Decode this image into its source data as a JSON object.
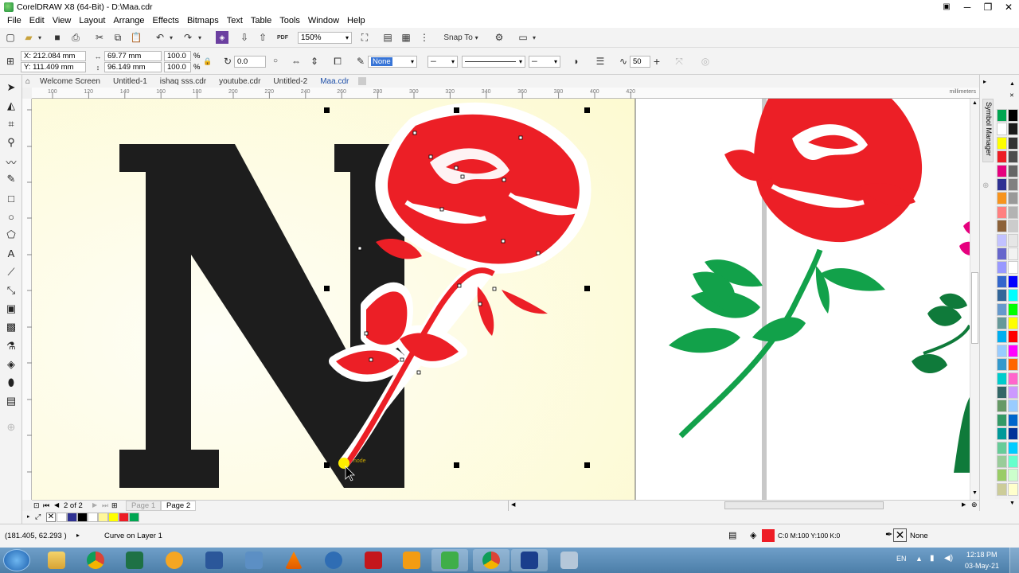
{
  "window": {
    "title": "CorelDRAW X8 (64-Bit) - D:\\Maa.cdr",
    "controls": [
      "minimize",
      "restore",
      "close"
    ]
  },
  "menu": [
    "File",
    "Edit",
    "View",
    "Layout",
    "Arrange",
    "Effects",
    "Bitmaps",
    "Text",
    "Table",
    "Tools",
    "Window",
    "Help"
  ],
  "standard_toolbar": {
    "zoom": "150%",
    "snap_label": "Snap To"
  },
  "property_bar": {
    "x": "X: 212.084 mm",
    "y": "Y: 111.409 mm",
    "width": "69.77 mm",
    "height": "96.149 mm",
    "scale_x": "100.0",
    "scale_y": "100.0",
    "pct": "%",
    "rotation": "0.0",
    "outline_width": "None",
    "smoothing": "50"
  },
  "tabs": [
    {
      "label": "Welcome Screen",
      "active": false
    },
    {
      "label": "Untitled-1",
      "active": false
    },
    {
      "label": "ishaq sss.cdr",
      "active": false
    },
    {
      "label": "youtube.cdr",
      "active": false
    },
    {
      "label": "Untitled-2",
      "active": false
    },
    {
      "label": "Maa.cdr",
      "active": true
    }
  ],
  "ruler": {
    "ticks": [
      "100",
      "120",
      "140",
      "160",
      "180",
      "200",
      "220",
      "240",
      "260",
      "280",
      "300",
      "320",
      "340",
      "360",
      "380",
      "400",
      "420"
    ],
    "unit": "millimeters"
  },
  "canvas": {
    "node_label": "node"
  },
  "docker": {
    "label": "Symbol Manager"
  },
  "page_nav": {
    "counter": "2 of 2",
    "pages": [
      "Page 1",
      "Page 2"
    ]
  },
  "status": {
    "coords": "(181.405, 62.293 )",
    "info": "Curve on Layer 1",
    "fill": "C:0 M:100 Y:100 K:0",
    "fill_color": "#ee1c25",
    "outline": "None"
  },
  "palette_colors": [
    "#00a651",
    "#000000",
    "#ffffff",
    "#1a1a1a",
    "#ffff00",
    "#333333",
    "#ed1c24",
    "#4d4d4d",
    "#e6007e",
    "#666666",
    "#2e3192",
    "#808080",
    "#f7941d",
    "#999999",
    "#ff8080",
    "#b3b3b3",
    "#8c6239",
    "#cccccc",
    "#c2c2ff",
    "#e6e6e6",
    "#6666cc",
    "#f2f2f2",
    "#9999ff",
    "#ffffff",
    "#3366cc",
    "#0000ff",
    "#336699",
    "#00ffff",
    "#6699cc",
    "#00ff00",
    "#669999",
    "#ffff00",
    "#00aeef",
    "#ff0000",
    "#99ccff",
    "#ff00ff",
    "#3399cc",
    "#ff6600",
    "#00cccc",
    "#ff66cc",
    "#336666",
    "#cc99ff",
    "#669966",
    "#99ccff",
    "#339966",
    "#0066cc",
    "#009999",
    "#003399",
    "#66cc99",
    "#00ccff",
    "#99cc99",
    "#66ffcc",
    "#99cc66",
    "#ccffcc",
    "#cccc99",
    "#ffffcc"
  ],
  "doc_palette": [
    "#ffffff",
    "#2e3192",
    "#000000",
    "#ffffff",
    "#fff799",
    "#ffff00",
    "#ed1c24",
    "#00a651"
  ],
  "taskbar": {
    "time": "12:18 PM",
    "date": "03-May-21",
    "lang": "EN"
  }
}
